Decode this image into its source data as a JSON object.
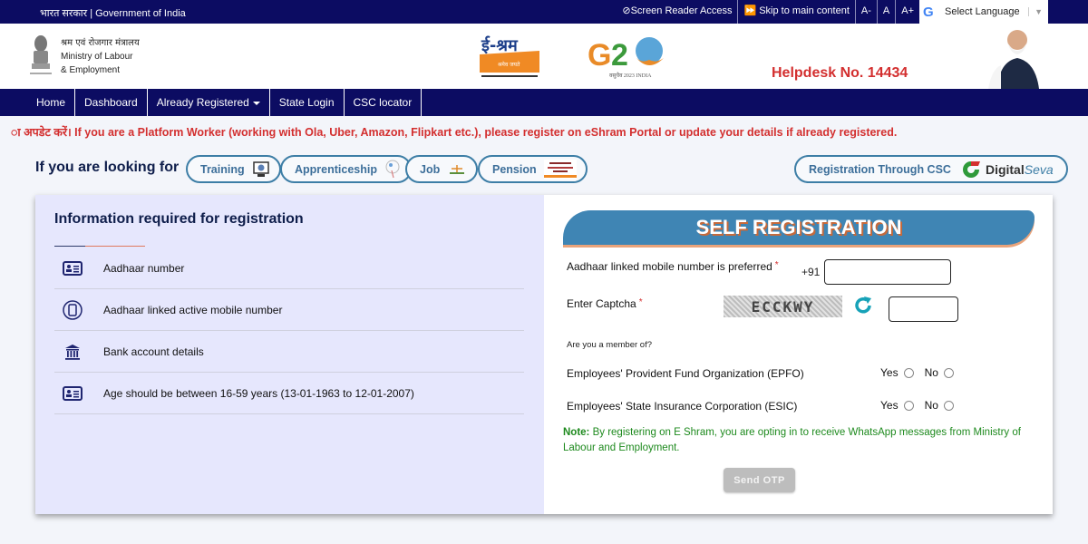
{
  "topbar": {
    "gov_label": "भारत सरकार | Government of India",
    "links": [
      {
        "icon": "eye-slash-icon",
        "label": "Screen Reader Access"
      },
      {
        "icon": "fast-forward-icon",
        "label": "Skip to main content"
      },
      {
        "label": "A-"
      },
      {
        "label": "A"
      },
      {
        "label": "A+"
      }
    ],
    "language": {
      "logo": "G",
      "selected": "Select Language"
    }
  },
  "header": {
    "ministry_hindi": "श्रम एवं रोजगार मंत्रालय",
    "ministry_line1": "Ministry of Labour",
    "ministry_line2": "& Employment",
    "eshram_logo_text": "ई-श्रम",
    "eshram_tagline": "श्रमेव जयते",
    "g20_text": "G20",
    "g20_caption": "2023 INDIA",
    "helpdesk": "Helpdesk No. 14434"
  },
  "nav": {
    "items": [
      {
        "label": "Home"
      },
      {
        "label": "Dashboard"
      },
      {
        "label": "Already Registered",
        "dropdown": true
      },
      {
        "label": "State Login"
      },
      {
        "label": "CSC locator"
      }
    ]
  },
  "announcement": "ा अपडेट करें। If you are a Platform Worker (working with Ola, Uber, Amazon, Flipkart etc.), please register on eShram Portal or update your details if already registered.",
  "looking_for": {
    "label": "If you are looking for",
    "options": [
      {
        "label": "Training",
        "icon": "training-computer-icon"
      },
      {
        "label": "Apprenticeship",
        "icon": "apprenticeship-bulb-icon"
      },
      {
        "label": "Job",
        "icon": "job-portal-icon"
      },
      {
        "label": "Pension",
        "icon": "pension-scheme-icon"
      }
    ],
    "csc": {
      "label": "Registration Through CSC",
      "brand_a": "Digital",
      "brand_b": "Seva"
    }
  },
  "info": {
    "title": "Information required for registration",
    "items": [
      {
        "icon": "id-card-icon",
        "text": "Aadhaar number"
      },
      {
        "icon": "mobile-phone-icon",
        "text": "Aadhaar linked active mobile number"
      },
      {
        "icon": "bank-icon",
        "text": "Bank account details"
      },
      {
        "icon": "id-card-icon",
        "text": "Age should be between 16-59 years (13-01-1963 to 12-01-2007)"
      }
    ]
  },
  "registration": {
    "title": "SELF REGISTRATION",
    "mobile_label": "Aadhaar linked mobile number is preferred",
    "required_mark": "*",
    "country_code": "+91",
    "mobile_value": "",
    "captcha_label": "Enter Captcha",
    "captcha_text": "ECCKWY",
    "captcha_value": "",
    "member_question": "Are you a member of?",
    "memberships": [
      {
        "label": "Employees' Provident Fund Organization (EPFO)",
        "yes": "Yes",
        "no": "No",
        "selected": null
      },
      {
        "label": "Employees' State Insurance Corporation (ESIC)",
        "yes": "Yes",
        "no": "No",
        "selected": null
      }
    ],
    "note_prefix": "Note:",
    "note_text": " By registering on E Shram, you are opting in to receive WhatsApp messages from Ministry of Labour and Employment.",
    "send_otp": "Send OTP"
  },
  "colors": {
    "navy": "#0c0c62",
    "accent_red": "#d32f2f",
    "pill_border": "#3d7ea6",
    "banner_blue": "#3f85b4",
    "note_green": "#1e8a1e",
    "info_bg": "#e6e7fd"
  }
}
